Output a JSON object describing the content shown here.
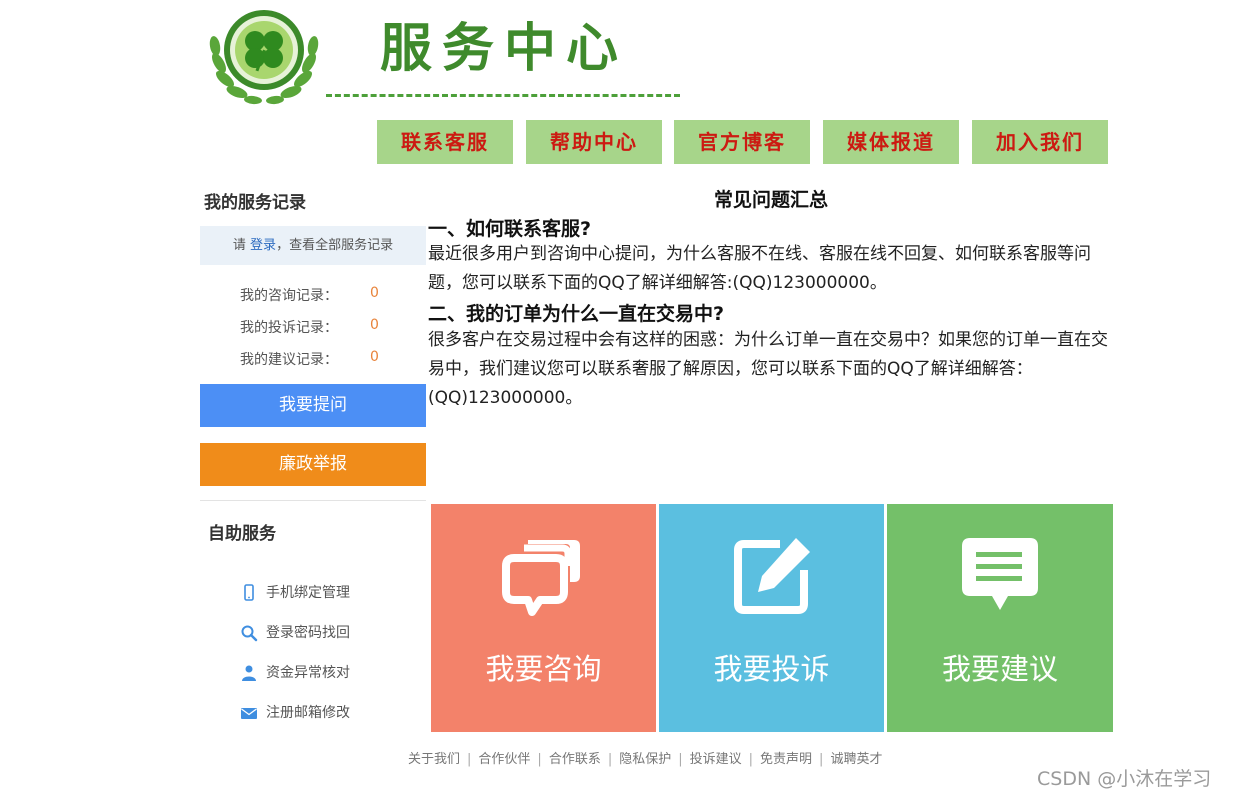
{
  "header": {
    "title": "服务中心"
  },
  "nav": [
    {
      "label": "联系客服"
    },
    {
      "label": "帮助中心"
    },
    {
      "label": "官方博客"
    },
    {
      "label": "媒体报道"
    },
    {
      "label": "加入我们"
    }
  ],
  "sidebar": {
    "records_title": "我的服务记录",
    "login_prefix": "请 ",
    "login_link": "登录",
    "login_suffix": "，查看全部服务记录",
    "records": [
      {
        "label": "我的咨询记录：",
        "count": "0"
      },
      {
        "label": "我的投诉记录：",
        "count": "0"
      },
      {
        "label": "我的建议记录：",
        "count": "0"
      }
    ],
    "ask_button": "我要提问",
    "report_button": "廉政举报",
    "self_service_title": "自助服务",
    "self_service": [
      {
        "label": "手机绑定管理",
        "icon": "phone-icon"
      },
      {
        "label": "登录密码找回",
        "icon": "search-icon"
      },
      {
        "label": "资金异常核对",
        "icon": "user-icon"
      },
      {
        "label": "注册邮箱修改",
        "icon": "mail-icon"
      }
    ]
  },
  "faq": {
    "title": "常见问题汇总",
    "items": [
      {
        "question": "一、如何联系客服?",
        "answer": "最近很多用户到咨询中心提问，为什么客服不在线、客服在线不回复、如何联系客服等问题，您可以联系下面的QQ了解详细解答:(QQ)123000000。"
      },
      {
        "question": "二、我的订单为什么一直在交易中?",
        "answer": "很多客户在交易过程中会有这样的困惑：为什么订单一直在交易中？如果您的订单一直在交易中，我们建议您可以联系奢服了解原因，您可以联系下面的QQ了解详细解答：(QQ)123000000。"
      }
    ]
  },
  "tiles": [
    {
      "label": "我要咨询",
      "icon": "chat-icon",
      "color": "#f3826a"
    },
    {
      "label": "我要投诉",
      "icon": "edit-icon",
      "color": "#5bbfe0"
    },
    {
      "label": "我要建议",
      "icon": "message-icon",
      "color": "#74c069"
    }
  ],
  "footer": {
    "links": [
      "关于我们",
      "合作伙伴",
      "合作联系",
      "隐私保护",
      "投诉建议",
      "免责声明",
      "诚聘英才"
    ],
    "separator": "|"
  },
  "watermark": "CSDN @小沐在学习",
  "colors": {
    "brand_green": "#3f8a2c",
    "nav_bg": "#a7d58a",
    "nav_text": "#cc1a12",
    "ask_button": "#4c8ff5",
    "report_button": "#f08c1a"
  }
}
